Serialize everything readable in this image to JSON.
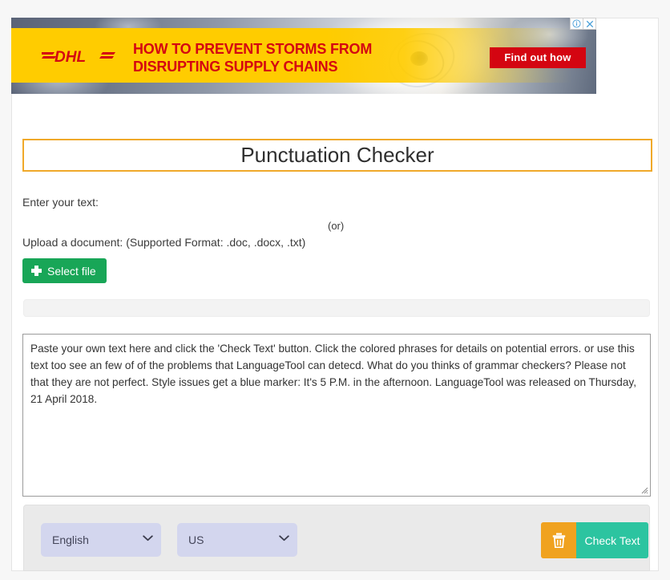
{
  "ad": {
    "brand": "DHL",
    "headline_line1": "HOW TO PREVENT STORMS FROM",
    "headline_line2": "DISRUPTING SUPPLY CHAINS",
    "cta_label": "Find out how",
    "info_icon": "info-circle-icon",
    "close_icon": "close-x-icon",
    "brand_yellow": "#ffcc00",
    "brand_red": "#d40511"
  },
  "header": {
    "title": "Punctuation Checker",
    "border_color": "#f0a92a"
  },
  "form": {
    "enter_text_label": "Enter your text:",
    "or_label": "(or)",
    "upload_label": "Upload a document: (Supported Format: .doc, .docx, .txt)",
    "select_file_label": "Select file",
    "select_file_icon": "plus-icon",
    "select_file_color": "#18a657",
    "progress_value": ""
  },
  "editor": {
    "value": "Paste your own text here and click the 'Check Text' button. Click the colored phrases for details on potential errors. or use this text too see an few of of the problems that LanguageTool can detecd. What do you thinks of grammar checkers? Please not that they are not perfect. Style issues get a blue marker: It's 5 P.M. in the afternoon. LanguageTool was released on Thursday, 21 April 2018.",
    "placeholder": "Paste your own text here and click the 'Check Text' button."
  },
  "footer": {
    "language": {
      "selected": "English",
      "options": [
        "English"
      ],
      "chevron_icon": "chevron-down-icon"
    },
    "variant": {
      "selected": "US",
      "options": [
        "US"
      ],
      "chevron_icon": "chevron-down-icon"
    },
    "clear_button": {
      "icon": "trash-icon",
      "color": "#f0a21f"
    },
    "check_button": {
      "label": "Check Text",
      "color": "#2cc4a0"
    }
  }
}
